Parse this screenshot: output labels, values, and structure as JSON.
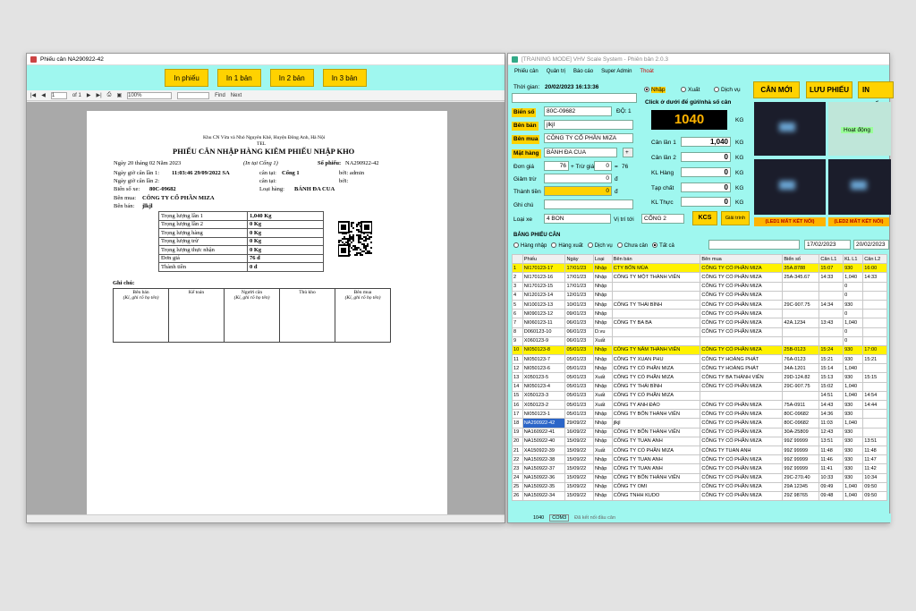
{
  "w1": {
    "title": "Phiếu cân NA290922-42",
    "buttons": [
      "In phiếu",
      "In 1 bản",
      "In 2 bản",
      "In 3 bản"
    ],
    "toolbar": {
      "page": "1",
      "of": "of 1",
      "zoom": "100%",
      "find": "Find",
      "next": "Next"
    }
  },
  "paper": {
    "company": "Khu CN Vừa và Nhỏ Nguyên Khê, Huyện Đông Anh, Hà Nội",
    "tel": "TEL",
    "title": "PHIẾU CÂN NHẬP HÀNG KIÊM PHIẾU NHẬP KHO",
    "date": "Ngày 20  tháng 02  Năm  2023",
    "place": "(In tại Cổng 1)",
    "so_phieu_label": "Số phiếu:",
    "so_phieu": "NA290922-42",
    "l1": "Ngày giờ cân lần 1:",
    "l1v": "11:03:46 29/09/2022 SA",
    "cantai1": "cân tại:",
    "cantai1v": "Cổng 1",
    "boi1": "bởi: admin",
    "l2": "Ngày giờ cân lần 2:",
    "cantai2": "cân tại:",
    "boi2": "bởi:",
    "bsx": "Biển số xe:",
    "bsxv": "80C-09682",
    "loaihang": "Loại hàng:",
    "loaihangv": "BÁNH ĐA CUA",
    "benmua": "Bên mua:",
    "benmuav": "CÔNG TY CỔ PHẦN MIZA",
    "benban": "Bên bán:",
    "benbanv": "jlkjl",
    "weights": [
      [
        "Trọng lượng lần 1",
        "1,040 Kg"
      ],
      [
        "Trọng lượng lần 2",
        "0 Kg"
      ],
      [
        "Trọng lượng hàng",
        "0 Kg"
      ],
      [
        "Trọng lượng trừ",
        "0 Kg"
      ],
      [
        "Trọng lượng thực nhận",
        "0 Kg"
      ],
      [
        "Đơn giá",
        "76 đ"
      ],
      [
        "Thành tiền",
        "0 đ"
      ]
    ],
    "ghichu": "Ghi chú:",
    "sig": [
      [
        "Bên bán",
        "(Kí, ghi rõ họ tên)"
      ],
      [
        "Kế toán",
        ""
      ],
      [
        "Người cân",
        "(Kí, ghi rõ họ tên)"
      ],
      [
        "Thủ kho",
        ""
      ],
      [
        "Bên mua",
        "(Kí, ghi rõ họ tên)"
      ]
    ]
  },
  "w2": {
    "title": "[TRAINING MODE] VHV Scale System - Phiên bản 2.0.3",
    "menu": [
      "Phiếu cân",
      "Quản trị",
      "Báo cáo",
      "Super Admin",
      "Thoát"
    ],
    "thoigian_label": "Thời gian:",
    "thoigian": "20/02/2023 16:13:36",
    "radio": [
      "Nhập",
      "Xuất",
      "Dịch vụ"
    ],
    "btn": [
      "CÂN MỚI",
      "LƯU PHIẾU",
      "IN PHIẾU"
    ],
    "click_hint": "Click ở dưới để gửi/nhả số cân",
    "weight": "1040",
    "kg": "KG",
    "bienso_label": "Biển số",
    "bienso": "80C-09682",
    "doi": "ĐỘ:",
    "doi_v": "1",
    "benban_label": "Bên bán",
    "benban": "jlkjl",
    "benmua_label": "Bên mua",
    "benmua": "CÔNG TY CỔ PHẦN MIZA",
    "mathang_label": "Mặt hàng",
    "mathang": "BÁNH ĐA CUA",
    "dongia_label": "Đơn giá",
    "dongia": "76",
    "trogia": "+ Trừ giá",
    "trogia_v": "0",
    "eq": "=",
    "eqv": "76",
    "giamtru_label": "Giảm trừ",
    "giamtru": "0",
    "d": "đ",
    "thanhtien_label": "Thành tiền",
    "thanhtien": "0",
    "ghichu_label": "Ghi chú",
    "loaixe_label": "Loại xe",
    "loaixe": "4 BON",
    "vitri_label": "Vị trí tới",
    "vitri": "CỔNG 2",
    "kcs": "KCS",
    "giaitrinh": "Giải trình",
    "canlan1": "Cân lần 1",
    "canlan1v": "1,040",
    "canlan2": "Cân lần 2",
    "canlan2v": "0",
    "klhang": "KL Hàng",
    "klhangv": "0",
    "tapchat": "Tạp chất",
    "tapchatv": "0",
    "klthuc": "KL Thực",
    "klthucv": "0",
    "hoatdong": "Hoạt động",
    "led1": "(LED1 MẤT KẾT NỐI)",
    "led2": "(LED2 MẤT KẾT NỐI)",
    "bang": "BẢNG PHIẾU CÂN",
    "filters": [
      "Hàng nhập",
      "Hàng xuất",
      "Dịch vụ",
      "Chưa cân",
      "Tất cả"
    ],
    "date_from": "17/02/2023",
    "date_to": "20/02/2023",
    "status": [
      "1040",
      "COM3",
      "Đã kết nối đầu cân"
    ]
  },
  "grid": {
    "cols": [
      "",
      "Phiếu",
      "Ngày",
      "Loại",
      "Bên bán",
      "Bên mua",
      "Biển số",
      "Cân L1",
      "KL L1",
      "Cân L2"
    ],
    "rows": [
      [
        "1",
        "NI170123-17",
        "17/01/23",
        "Nhập",
        "CTY BỐN MÙA",
        "CÔNG TY CỔ PHẦN MIZA",
        "35A.8788",
        "15:07",
        "930",
        "16:00",
        "hl"
      ],
      [
        "2",
        "NI170123-16",
        "17/01/23",
        "Nhập",
        "CÔNG TY MỘT THÀNH VIÊN",
        "CÔNG TY CỔ PHẦN MIZA",
        "25A-345.67",
        "14:33",
        "1,040",
        "14:33",
        ""
      ],
      [
        "3",
        "NI170123-15",
        "17/01/23",
        "Nhập",
        "",
        "CÔNG TY CỔ PHẦN MIZA",
        "",
        "",
        "0",
        "",
        ""
      ],
      [
        "4",
        "NI120123-14",
        "12/01/23",
        "Nhập",
        "",
        "CÔNG TY CỔ PHẦN MIZA",
        "",
        "",
        "0",
        "",
        ""
      ],
      [
        "5",
        "NI100123-13",
        "10/01/23",
        "Nhập",
        "CÔNG TY THÁI BÌNH",
        "CÔNG TY CỔ PHẦN MIZA",
        "29C-907.75",
        "14:34",
        "930",
        "",
        ""
      ],
      [
        "6",
        "NI090123-12",
        "09/01/23",
        "Nhập",
        "",
        "CÔNG TY CỔ PHẦN MIZA",
        "",
        "",
        "0",
        "",
        ""
      ],
      [
        "7",
        "NI060123-11",
        "06/01/23",
        "Nhập",
        "CÔNG TY BA BA",
        "CÔNG TY CỔ PHẦN MIZA",
        "42A.1234",
        "13:43",
        "1,040",
        "",
        ""
      ],
      [
        "8",
        "D060123-10",
        "06/01/23",
        "D.vu",
        "",
        "CÔNG TY CỔ PHẦN MIZA",
        "",
        "",
        "0",
        "",
        ""
      ],
      [
        "9",
        "X060123-9",
        "06/01/23",
        "Xuất",
        "",
        "",
        "",
        "",
        "0",
        "",
        ""
      ],
      [
        "10",
        "NI050123-8",
        "05/01/23",
        "Nhập",
        "CÔNG TY NĂM THÀNH VIÊN",
        "CÔNG TY CỔ PHẦN MIZA",
        "25B-0123",
        "15:24",
        "930",
        "17:00",
        "hl"
      ],
      [
        "11",
        "NI050123-7",
        "05/01/23",
        "Nhập",
        "CÔNG TY XUAN PHU",
        "CÔNG TY HOÀNG PHÁT",
        "76A-0123",
        "15:21",
        "930",
        "15:21",
        ""
      ],
      [
        "12",
        "NI050123-6",
        "05/01/23",
        "Nhập",
        "CÔNG TY CỔ PHẦN MIZA",
        "CÔNG TY HOÀNG PHÁT",
        "34A-1201",
        "15:14",
        "1,040",
        "",
        ""
      ],
      [
        "13",
        "X050123-5",
        "05/01/23",
        "Xuất",
        "CÔNG TY CỔ PHẦN MIZA",
        "CÔNG TY BA THÀNH VIÊN",
        "29D-124.82",
        "15:13",
        "930",
        "15:15",
        ""
      ],
      [
        "14",
        "NI050123-4",
        "05/01/23",
        "Nhập",
        "CÔNG TY THÁI BÌNH",
        "CÔNG TY CỔ PHẦN MIZA",
        "29C-907.75",
        "15:02",
        "1,040",
        "",
        ""
      ],
      [
        "15",
        "X050123-3",
        "05/01/23",
        "Xuất",
        "CÔNG TY CỔ PHẦN MIZA",
        "",
        "",
        "14:51",
        "1,040",
        "14:54",
        ""
      ],
      [
        "16",
        "X050123-2",
        "05/01/23",
        "Xuất",
        "CÔNG TY ANH ĐÀO",
        "CÔNG TY CỔ PHẦN MIZA",
        "75A-0911",
        "14:43",
        "930",
        "14:44",
        ""
      ],
      [
        "17",
        "NI050123-1",
        "05/01/23",
        "Nhập",
        "CÔNG TY BỐN THÀNH VIÊN",
        "CÔNG TY CỔ PHẦN MIZA",
        "80C-09682",
        "14:36",
        "930",
        "",
        ""
      ],
      [
        "18",
        "NA290922-42",
        "29/09/22",
        "Nhập",
        "jlkjl",
        "CÔNG TY CỔ PHẦN MIZA",
        "80C-09682",
        "11:03",
        "1,040",
        "",
        "sel"
      ],
      [
        "19",
        "NA160922-41",
        "16/09/22",
        "Nhập",
        "CÔNG TY BỐN THÀNH VIÊN",
        "CÔNG TY CỔ PHẦN MIZA",
        "30A-25809",
        "12:43",
        "930",
        "",
        ""
      ],
      [
        "20",
        "NA150922-40",
        "15/09/22",
        "Nhập",
        "CÔNG TY TUAN ANH",
        "CÔNG TY CỔ PHẦN MIZA",
        "99Z 99999",
        "13:51",
        "930",
        "13:51",
        ""
      ],
      [
        "21",
        "XA150922-39",
        "15/09/22",
        "Xuất",
        "CÔNG TY CỔ PHẦN MIZA",
        "CÔNG TY TUAN ANH",
        "99Z 99999",
        "11:48",
        "930",
        "11:48",
        ""
      ],
      [
        "22",
        "NA150922-38",
        "15/09/22",
        "Nhập",
        "CÔNG TY TUAN ANH",
        "CÔNG TY CỔ PHẦN MIZA",
        "99Z 99999",
        "11:46",
        "930",
        "11:47",
        ""
      ],
      [
        "23",
        "NA150922-37",
        "15/09/22",
        "Nhập",
        "CÔNG TY TUAN ANH",
        "CÔNG TY CỔ PHẦN MIZA",
        "99Z 99999",
        "11:41",
        "930",
        "11:42",
        ""
      ],
      [
        "24",
        "NA150922-36",
        "15/09/22",
        "Nhập",
        "CÔNG TY BỐN THÀNH VIÊN",
        "CÔNG TY CỔ PHẦN MIZA",
        "29C-270.40",
        "10:33",
        "930",
        "10:34",
        ""
      ],
      [
        "25",
        "NA150922-35",
        "15/09/22",
        "Nhập",
        "CÔNG TY OMI",
        "CÔNG TY CỔ PHẦN MIZA",
        "29A 12345",
        "09:49",
        "1,040",
        "09:50",
        ""
      ],
      [
        "26",
        "NA150922-34",
        "15/09/22",
        "Nhập",
        "CÔNG TNHH KUDO",
        "CÔNG TY CỔ PHẦN MIZA",
        "29Z 98765",
        "09:48",
        "1,040",
        "09:50",
        ""
      ]
    ]
  }
}
